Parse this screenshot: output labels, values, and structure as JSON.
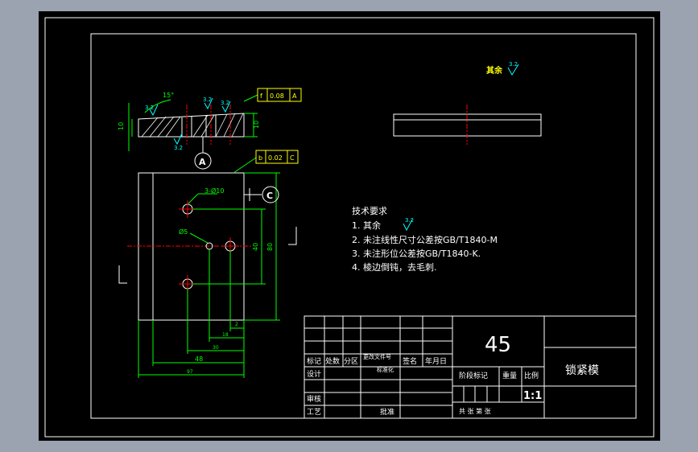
{
  "colors": {
    "background": "#9ba3b1",
    "paper": "#000000",
    "border": "#ffffff",
    "dimension": "#00ff00",
    "centerline": "#ff0000",
    "hatch": "#ffffff",
    "frame_callout": "#ffff00",
    "roughness": "#00ffff"
  },
  "icons": {
    "roughness": "surface-roughness-symbol",
    "datum": "datum-circle-symbol"
  },
  "top_right_note": {
    "label": "其余",
    "roughness_value": "3.2"
  },
  "section_view": {
    "angle_label": "15°",
    "roughness_values": [
      "3.2",
      "3.2",
      "3.2"
    ],
    "height_left": "10",
    "height_right": "10",
    "tolerance_frame_parallel": [
      "f",
      "0.08",
      "A"
    ],
    "datum_a": "A",
    "bottom_roughness": "3.2"
  },
  "front_view": {
    "tolerance_frame_position": [
      "b",
      "0.02",
      "C"
    ],
    "datum_c": "C",
    "hole_large_label": "3-Ø10",
    "hole_small_label": "Ø5",
    "dim_40": "40",
    "dim_80": "80",
    "dim_2": "2",
    "dim_18": "18",
    "dim_30": "30",
    "dim_48": "48",
    "dim_97": "97"
  },
  "technical_requirements": {
    "title": "技术要求",
    "items": [
      "1.  其余",
      "2.  未注线性尺寸公差按GB/T1840-M",
      "3.  未注形位公差按GB/T1840-K.",
      "4.  棱边倒钝，去毛刺."
    ],
    "item1_roughness": "3.2"
  },
  "title_block": {
    "material": "45",
    "part_name": "锁紧模",
    "scale": "1:1",
    "headers_row": [
      "标记",
      "处数",
      "分区",
      "更改文件号",
      "签名",
      "年月日"
    ],
    "design_label": "设计",
    "standardization_label": "标准化",
    "stage_label": "阶段标记",
    "weight_label": "重量",
    "scale_label": "比例",
    "check_label": "审核",
    "process_label": "工艺",
    "approve_label": "批准",
    "sheets_label": "共  张     第  张"
  }
}
